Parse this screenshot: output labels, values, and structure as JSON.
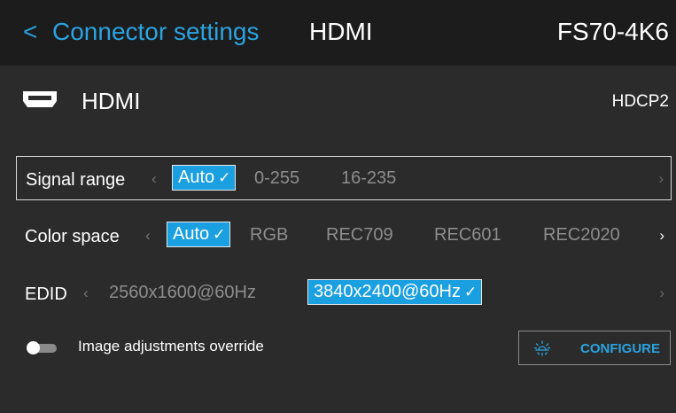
{
  "header": {
    "back_icon": "chevron-left-icon",
    "title": "Connector settings",
    "subtitle": "HDMI",
    "device": "FS70-4K6",
    "accent_color": "#2ba3e0"
  },
  "connector": {
    "icon": "hdmi-port-icon",
    "name": "HDMI",
    "hdcp": "HDCP2"
  },
  "settings": [
    {
      "label": "Signal range",
      "focused": true,
      "options": [
        {
          "label": "Auto",
          "selected": true
        },
        {
          "label": "0-255",
          "selected": false
        },
        {
          "label": "16-235",
          "selected": false
        }
      ]
    },
    {
      "label": "Color space",
      "focused": false,
      "options": [
        {
          "label": "Auto",
          "selected": true
        },
        {
          "label": "RGB",
          "selected": false
        },
        {
          "label": "REC709",
          "selected": false
        },
        {
          "label": "REC601",
          "selected": false
        },
        {
          "label": "REC2020",
          "selected": false
        }
      ]
    },
    {
      "label": "EDID",
      "focused": false,
      "options": [
        {
          "label": "2560x1600@60Hz",
          "selected": false
        },
        {
          "label": "3840x2400@60Hz",
          "selected": true
        }
      ]
    }
  ],
  "override": {
    "label": "Image adjustments override",
    "enabled": false
  },
  "configure": {
    "label": "CONFIGURE",
    "icon": "brightness-icon"
  },
  "glyphs": {
    "left": "‹",
    "right": "›",
    "check": "✓",
    "back": "<"
  }
}
